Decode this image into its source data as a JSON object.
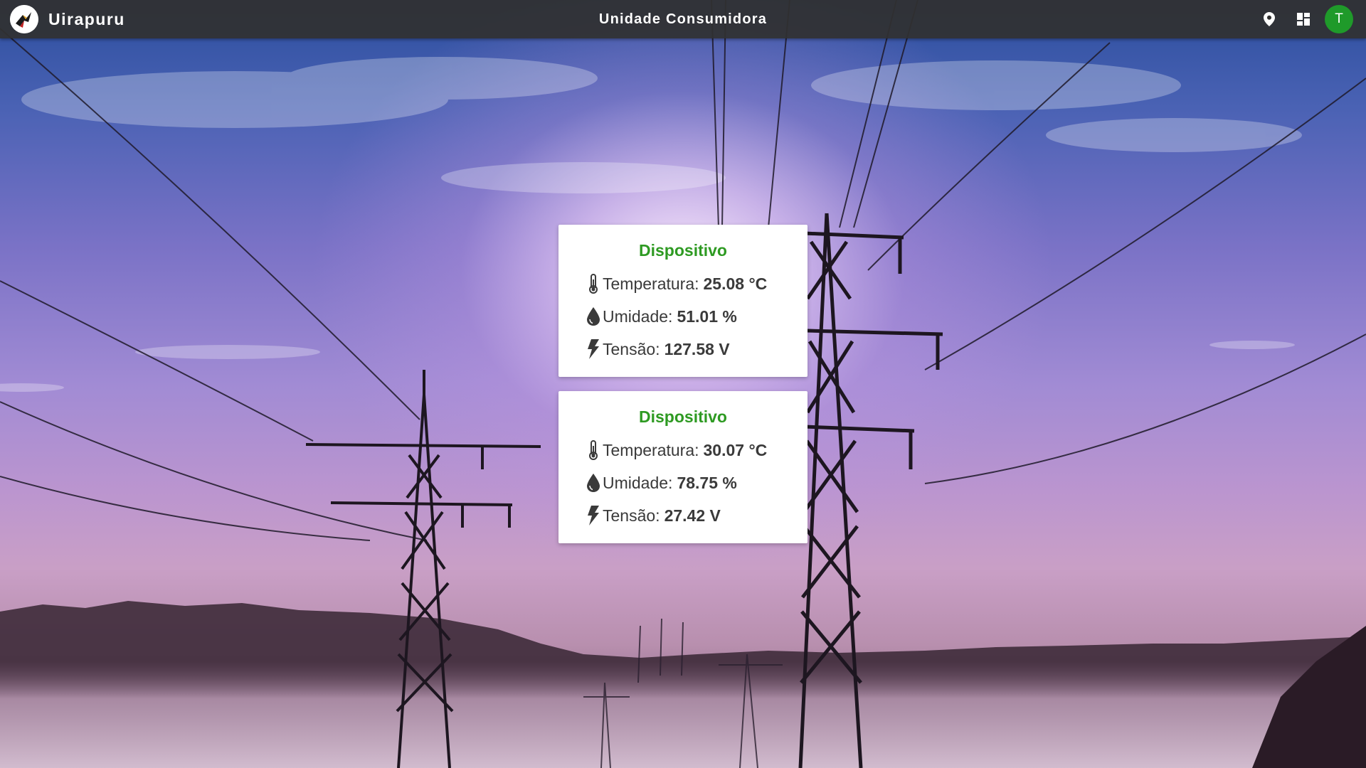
{
  "app": {
    "name": "Uirapuru",
    "page_title": "Unidade Consumidora"
  },
  "header": {
    "icons": [
      "location-pin-icon",
      "dashboard-grid-icon"
    ],
    "avatar_letter": "T",
    "avatar_color": "#1f9a2a"
  },
  "devices": [
    {
      "title": "Dispositivo",
      "temperature_label": "Temperatura:",
      "temperature_value": "25.08 °C",
      "humidity_label": "Umidade:",
      "humidity_value": "51.01 %",
      "voltage_label": "Tensão:",
      "voltage_value": "127.58 V"
    },
    {
      "title": "Dispositivo",
      "temperature_label": "Temperatura:",
      "temperature_value": "30.07 °C",
      "humidity_label": "Umidade:",
      "humidity_value": "78.75 %",
      "voltage_label": "Tensão:",
      "voltage_value": "27.42 V"
    }
  ],
  "colors": {
    "topbar": "#303030",
    "card_title": "#2e9a22",
    "text": "#3a3a3a"
  }
}
